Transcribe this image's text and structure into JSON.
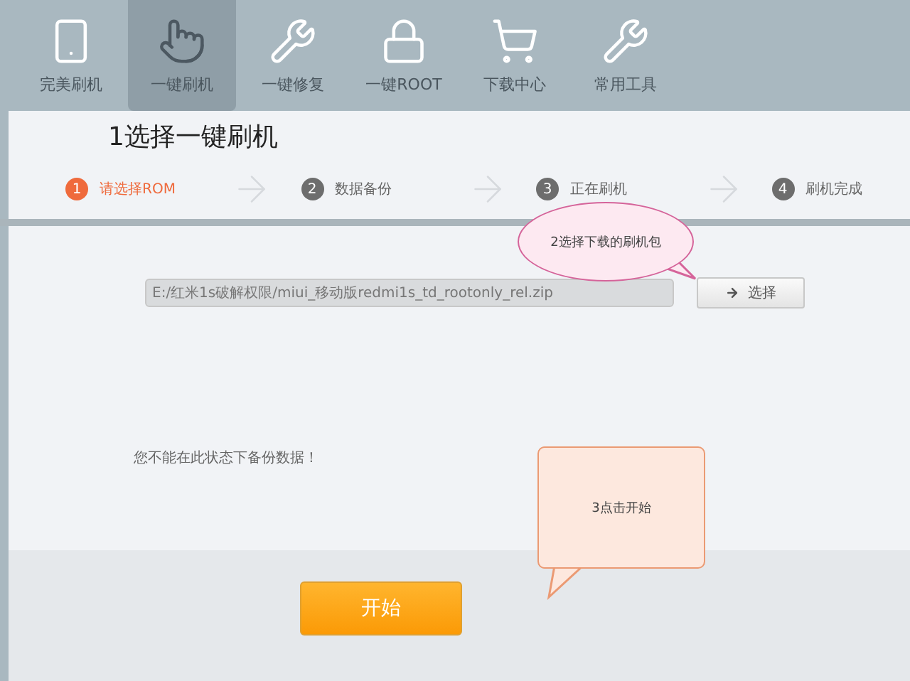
{
  "toolbar": [
    {
      "label": "完美刷机",
      "kind": "android",
      "selected": false
    },
    {
      "label": "一键刷机",
      "kind": "touch",
      "selected": true
    },
    {
      "label": "一键修复",
      "kind": "repair",
      "selected": false
    },
    {
      "label": "一键ROOT",
      "kind": "lock",
      "selected": false
    },
    {
      "label": "下载中心",
      "kind": "cart",
      "selected": false
    },
    {
      "label": "常用工具",
      "kind": "tools",
      "selected": false
    }
  ],
  "heading": "1选择一键刷机",
  "steps": [
    {
      "number": "1",
      "label": "请选择ROM",
      "active": true
    },
    {
      "number": "2",
      "label": "数据备份",
      "active": false
    },
    {
      "number": "3",
      "label": "正在刷机",
      "active": false
    },
    {
      "number": "4",
      "label": "刷机完成",
      "active": false
    }
  ],
  "rom_path": {
    "value": "E:/红米1s破解权限/miui_移动版redmi1s_td_rootonly_rel.zip"
  },
  "choose_button": "选择",
  "notice": "您不能在此状态下备份数据！",
  "start_button": "开始",
  "callouts": [
    {
      "kind": "ellipse",
      "text": "2选择下载的刷机包"
    },
    {
      "kind": "box",
      "text": "3点击开始"
    }
  ]
}
